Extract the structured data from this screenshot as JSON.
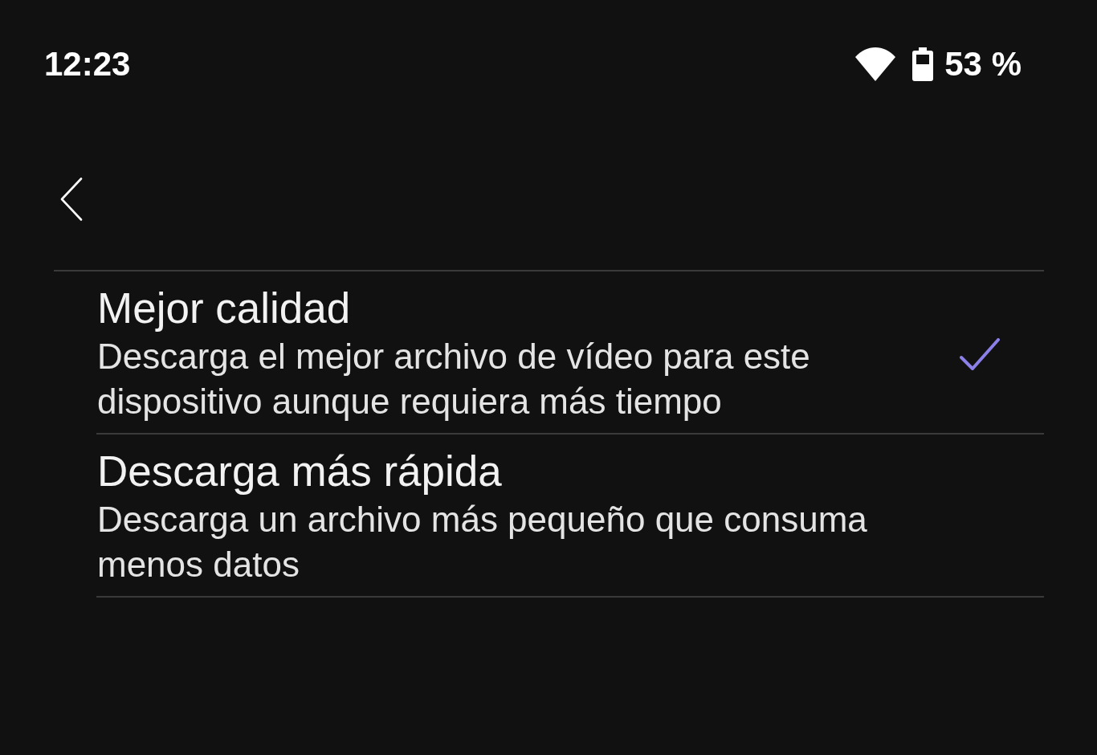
{
  "status_bar": {
    "time": "12:23",
    "battery": "53 %"
  },
  "options": [
    {
      "title": "Mejor calidad",
      "description": "Descarga el mejor archivo de vídeo para este dispositivo aunque requiera más tiempo",
      "selected": true
    },
    {
      "title": "Descarga más rápida",
      "description": "Descarga un archivo más pequeño que consuma menos datos",
      "selected": false
    }
  ]
}
